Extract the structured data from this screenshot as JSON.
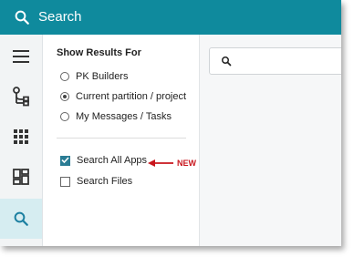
{
  "header": {
    "title": "Search",
    "icon": "search-icon",
    "bar_color": "#0f8a9d"
  },
  "rail": {
    "items": [
      {
        "icon": "hamburger-menu-icon"
      },
      {
        "icon": "workflow-tree-icon"
      },
      {
        "icon": "apps-grid-icon"
      },
      {
        "icon": "dashboard-icon"
      },
      {
        "icon": "search-icon",
        "active": true
      }
    ],
    "active_color": "#d6edf1"
  },
  "filter_panel": {
    "title": "Show Results For",
    "scope_options": [
      {
        "label": "PK Builders",
        "selected": false
      },
      {
        "label": "Current partition / project",
        "selected": true
      },
      {
        "label": "My Messages / Tasks",
        "selected": false
      }
    ],
    "checkboxes": [
      {
        "label": "Search All Apps",
        "checked": true
      },
      {
        "label": "Search Files",
        "checked": false
      }
    ]
  },
  "results": {
    "search_placeholder": ""
  },
  "annotation": {
    "text": "NEW",
    "color": "#c8161d"
  }
}
